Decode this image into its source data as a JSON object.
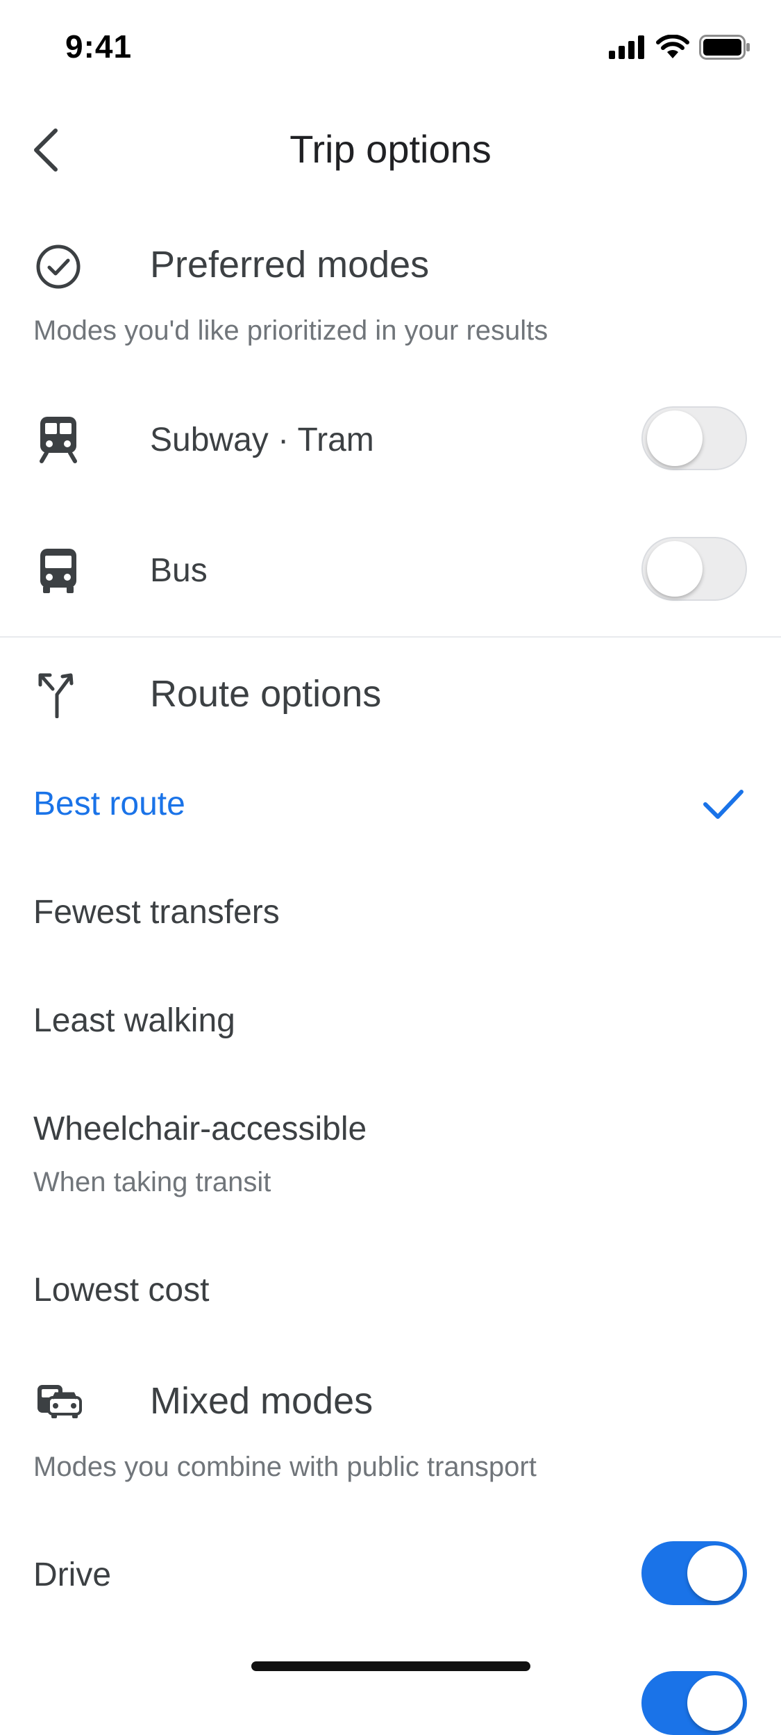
{
  "status_bar": {
    "time": "9:41"
  },
  "header": {
    "title": "Trip options"
  },
  "preferred_modes": {
    "title": "Preferred modes",
    "subtitle": "Modes you'd like prioritized in your results",
    "items": [
      {
        "label": "Subway · Tram",
        "icon": "subway-icon",
        "enabled": false
      },
      {
        "label": "Bus",
        "icon": "bus-icon",
        "enabled": false
      }
    ]
  },
  "route_options": {
    "title": "Route options",
    "items": [
      {
        "label": "Best route",
        "selected": true
      },
      {
        "label": "Fewest transfers",
        "selected": false
      },
      {
        "label": "Least walking",
        "selected": false
      },
      {
        "label": "Wheelchair-accessible",
        "sublabel": "When taking transit",
        "selected": false
      },
      {
        "label": "Lowest cost",
        "selected": false
      }
    ]
  },
  "mixed_modes": {
    "title": "Mixed modes",
    "subtitle": "Modes you combine with public transport",
    "items": [
      {
        "label": "Drive",
        "enabled": true
      }
    ]
  },
  "colors": {
    "accent": "#1a73e8",
    "text": "#3c4043",
    "secondary": "#70757a"
  }
}
